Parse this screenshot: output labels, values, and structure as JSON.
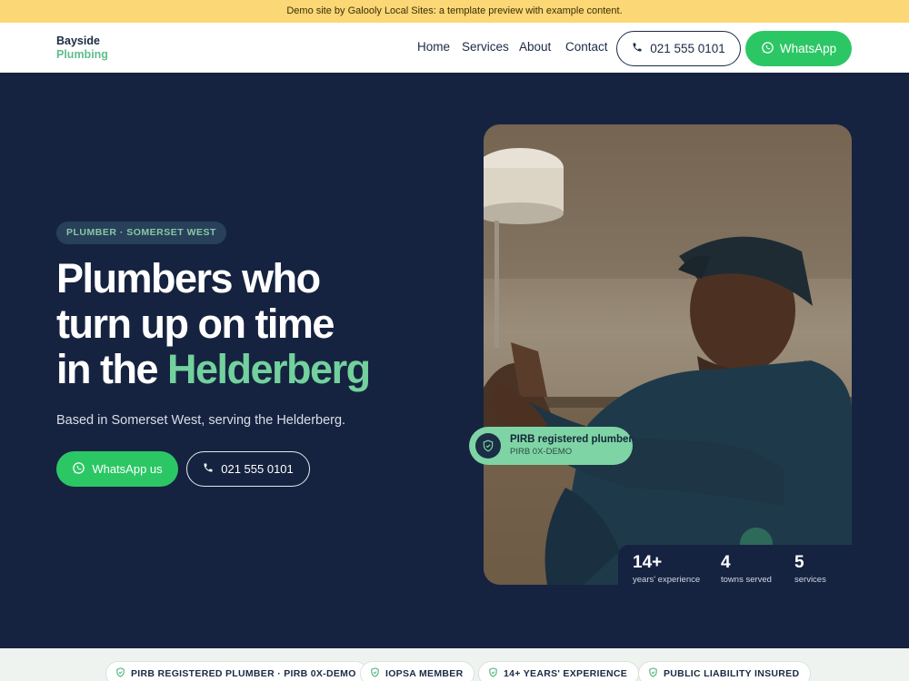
{
  "banner": {
    "text": "Demo site by Galooly Local Sites: a template preview with example content."
  },
  "header": {
    "logo_line1": "Bayside",
    "logo_line2": "Plumbing",
    "nav": [
      "Home",
      "Services",
      "About",
      "Contact"
    ],
    "phone": "021 555 0101",
    "whatsapp": "WhatsApp"
  },
  "hero": {
    "badge": "PLUMBER · SOMERSET WEST",
    "headline_line1": "Plumbers who",
    "headline_line2": "turn up on time",
    "headline_line3a": "in the ",
    "headline_accent": "Helderberg",
    "subtitle": "Based in Somerset West, serving the Helderberg.",
    "whatsapp_button": "WhatsApp us",
    "phone_button": "021 555 0101"
  },
  "credential": {
    "title": "PIRB registered plumber",
    "number": "PIRB 0X-DEMO"
  },
  "stats": [
    {
      "value": "14+",
      "label": "years' experience"
    },
    {
      "value": "4",
      "label": "towns served"
    },
    {
      "value": "5",
      "label": "services"
    }
  ],
  "trust": [
    "PIRB REGISTERED PLUMBER · PIRB 0X-DEMO",
    "IOPSA MEMBER",
    "14+ YEARS' EXPERIENCE",
    "PUBLIC LIABILITY INSURED"
  ],
  "colors": {
    "navy": "#162340",
    "accent_green": "#72d19d",
    "whatsapp_green": "#2cc765",
    "banner_yellow": "#fcd775"
  },
  "icons": {
    "phone": "phone-icon",
    "whatsapp": "whatsapp-icon",
    "shield": "shield-check-icon"
  }
}
